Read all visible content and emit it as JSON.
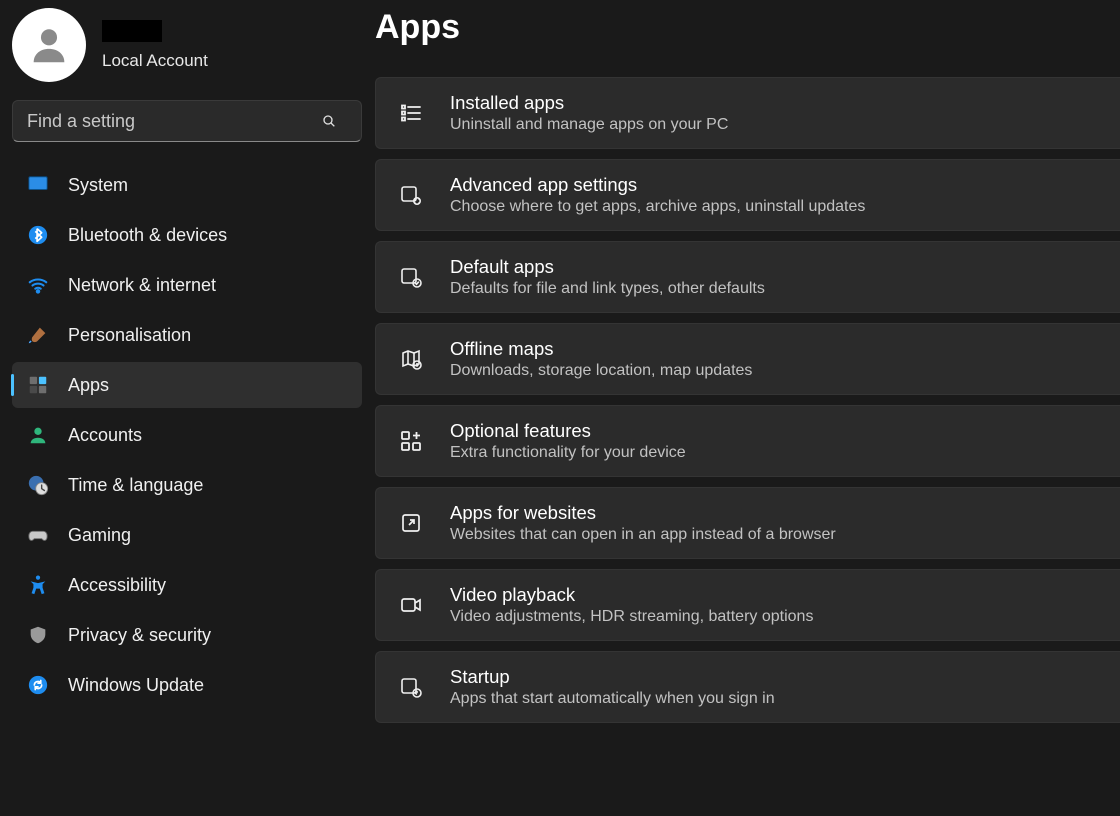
{
  "profile": {
    "name": "",
    "subtitle": "Local Account"
  },
  "search": {
    "placeholder": "Find a setting"
  },
  "nav": {
    "items": [
      {
        "label": "System"
      },
      {
        "label": "Bluetooth & devices"
      },
      {
        "label": "Network & internet"
      },
      {
        "label": "Personalisation"
      },
      {
        "label": "Apps"
      },
      {
        "label": "Accounts"
      },
      {
        "label": "Time & language"
      },
      {
        "label": "Gaming"
      },
      {
        "label": "Accessibility"
      },
      {
        "label": "Privacy & security"
      },
      {
        "label": "Windows Update"
      }
    ],
    "selected_index": 4
  },
  "page": {
    "title": "Apps",
    "cards": [
      {
        "title": "Installed apps",
        "sub": "Uninstall and manage apps on your PC"
      },
      {
        "title": "Advanced app settings",
        "sub": "Choose where to get apps, archive apps, uninstall updates"
      },
      {
        "title": "Default apps",
        "sub": "Defaults for file and link types, other defaults"
      },
      {
        "title": "Offline maps",
        "sub": "Downloads, storage location, map updates"
      },
      {
        "title": "Optional features",
        "sub": "Extra functionality for your device"
      },
      {
        "title": "Apps for websites",
        "sub": "Websites that can open in an app instead of a browser"
      },
      {
        "title": "Video playback",
        "sub": "Video adjustments, HDR streaming, battery options"
      },
      {
        "title": "Startup",
        "sub": "Apps that start automatically when you sign in"
      }
    ]
  }
}
